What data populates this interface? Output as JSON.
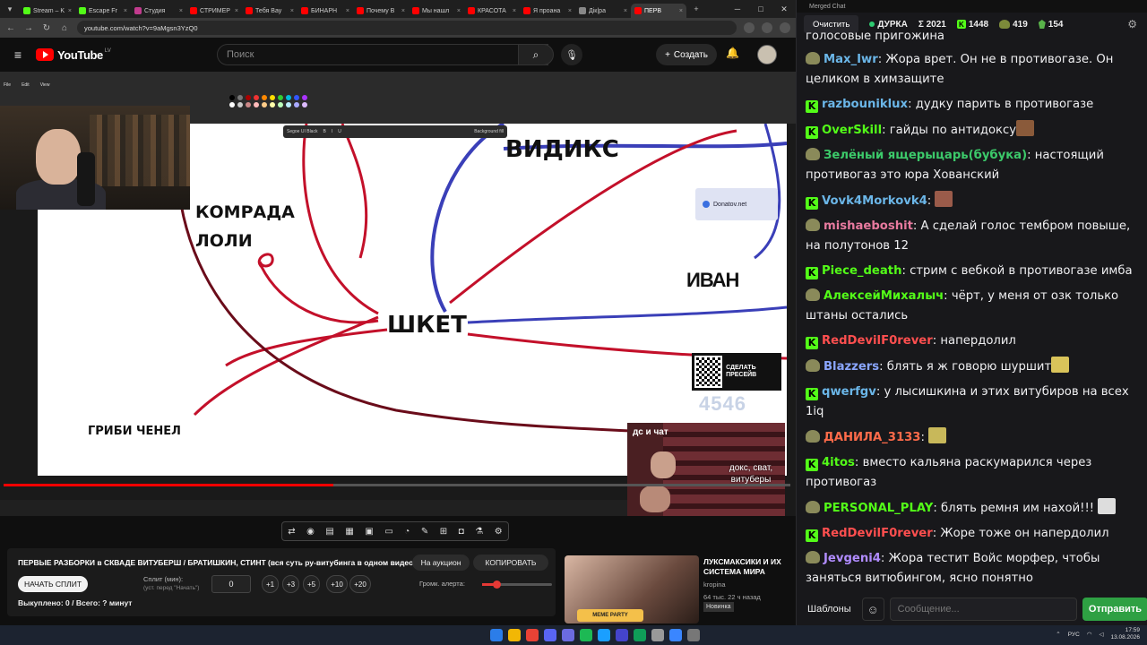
{
  "browser": {
    "tabs": [
      {
        "label": "Stream – K",
        "color": "#53fc18"
      },
      {
        "label": "Escape Fr",
        "color": "#53fc18"
      },
      {
        "label": "Студия ",
        "color": "#c23b8e"
      },
      {
        "label": "СТРИМЕР",
        "color": "#ff0000"
      },
      {
        "label": "Тебя Вау",
        "color": "#ff0000"
      },
      {
        "label": "БИНАРН",
        "color": "#ff0000"
      },
      {
        "label": "Почему В",
        "color": "#ff0000"
      },
      {
        "label": "Мы нашл",
        "color": "#ff0000"
      },
      {
        "label": "КРАСОТА",
        "color": "#ff0000"
      },
      {
        "label": "Я проана",
        "color": "#ff0000"
      },
      {
        "label": "Дiк|ра",
        "color": "#888888"
      },
      {
        "label": "ПЕРВ",
        "color": "#ff0000",
        "active": true
      }
    ],
    "url": "youtube.com/watch?v=9aMgsn3YzQ0"
  },
  "youtube": {
    "logo": "YouTube",
    "region": "LV",
    "search_placeholder": "Поиск",
    "create_label": "Создать",
    "create_plus": "+"
  },
  "video": {
    "labels": {
      "vidiks": "ВИДИКС",
      "komrada": "КОМРАДА",
      "loli": "ЛОЛИ",
      "shket": "ШКЕТ",
      "gribi": "ГРИБИ ЧЕНЕЛ",
      "ivan": "ИВАН"
    },
    "font_box": "Segoe UI Black",
    "background_fill": "Background fill",
    "donat_site": "Donatov.net",
    "qr_text": "СДЕЛАТЬ ПРЕСЕЙВ",
    "counter": "4546",
    "ds_chat": "дс и чат",
    "ds_caption": "докс, сват, витуберы"
  },
  "info": {
    "title": "ПЕРВЫЕ РАЗБОРКИ в СКВАДЕ ВИТУБЕРШ / БРАТИШКИН, СТИНТ (вся суть ру-витубинга в одном видео)",
    "auction": "На аукцион",
    "copy": "КОПИРОВАТЬ",
    "start_split": "НАЧАТЬ СПЛИТ",
    "split_label": "Сплит (мин):",
    "split_hint": "(уст. перед \"Начать\")",
    "split_value": "0",
    "steps": [
      "+1",
      "+3",
      "+5",
      "+10",
      "+20"
    ],
    "volume_label": "Громк. алерта:",
    "volume": 0.2,
    "bought": "Выкуплено: 0 / Всего: ? минут"
  },
  "related": {
    "title": "ЛУКСМАКСИКИ И ИХ СИСТЕМА МИРА",
    "channel": "kropina",
    "meta": "64 тыс.   22 ч назад",
    "badge": "Новинка",
    "meme": "MEME PARTY"
  },
  "chat": {
    "window_title": "Merged Chat",
    "clear": "Очистить",
    "stream_name": "ДУРКА",
    "total": "Σ 2021",
    "kick_count": "1448",
    "twitch_count": "419",
    "other_count": "154",
    "top_fragment": "голосовые пригожина",
    "messages": [
      {
        "platform": "twitch",
        "nick": "Max_Iwr",
        "color": "#6bb6e8",
        "text": "Жора врет. Он не в противогазе. Он целиком в химзащите"
      },
      {
        "platform": "kick",
        "nick": "razbouniklux",
        "color": "#6bb6e8",
        "text": "дудку парить в противогазе"
      },
      {
        "platform": "kick",
        "nick": "OverSkill",
        "color": "#53fc18",
        "text": "гайды по антидоксу",
        "emote": "#8a5a3a"
      },
      {
        "platform": "twitch",
        "nick": "Зелёный ящерыцарь(бубука)",
        "color": "#3cc96a",
        "text": "настоящий противогаз это юра Хованский"
      },
      {
        "platform": "kick",
        "nick": "Vovk4Morkovk4",
        "color": "#6bb6e8",
        "text": "",
        "emote": "#9a5b4a"
      },
      {
        "platform": "twitch",
        "nick": "mishaeboshit",
        "color": "#e87a9f",
        "text": "А сделай голос тембром повыше, на полутонов 12"
      },
      {
        "platform": "kick",
        "nick": "Piece_death",
        "color": "#53fc18",
        "text": "стрим с вебкой в противогазе имба"
      },
      {
        "platform": "twitch",
        "nick": "АлексейМихалыч",
        "color": "#53fc18",
        "text": "чёрт, у меня от озк только штаны остались"
      },
      {
        "platform": "kick",
        "nick": "RedDevilF0rever",
        "color": "#ff4f4f",
        "text": "напердолил"
      },
      {
        "platform": "twitch",
        "nick": "Blazzers",
        "color": "#8aa6ff",
        "text": "блять я ж говорю шуршит",
        "emote": "#d9c35a"
      },
      {
        "platform": "kick",
        "nick": "qwerfgv",
        "color": "#6bb6e8",
        "text": "у лысишкина и этих витубиров на всех 1iq"
      },
      {
        "platform": "twitch",
        "nick": "ДАНИЛА_3133",
        "color": "#ff6b4a",
        "text": "",
        "emote": "#c8b85a"
      },
      {
        "platform": "kick",
        "nick": "4itos",
        "color": "#53fc18",
        "text": "вместо кальяна раскумарился через противогаз"
      },
      {
        "platform": "twitch",
        "nick": "PERSONAL_PLAY",
        "color": "#53fc18",
        "text": "блять ремня им нахой!!! ",
        "emote": "#dddddd"
      },
      {
        "platform": "kick",
        "nick": "RedDevilF0rever",
        "color": "#ff4f4f",
        "text": "Жоре тоже он напердолил"
      },
      {
        "platform": "twitch",
        "nick": "Jevgeni4",
        "color": "#b18cff",
        "text": "Жора тестит Войс морфер, чтобы заняться витюбингом, ясно понятно"
      }
    ],
    "templates": "Шаблоны",
    "input_placeholder": "Сообщение...",
    "send": "Отправить"
  },
  "taskbar": {
    "lang": "РУС",
    "time": "17:59",
    "date": "13.08.2026"
  }
}
